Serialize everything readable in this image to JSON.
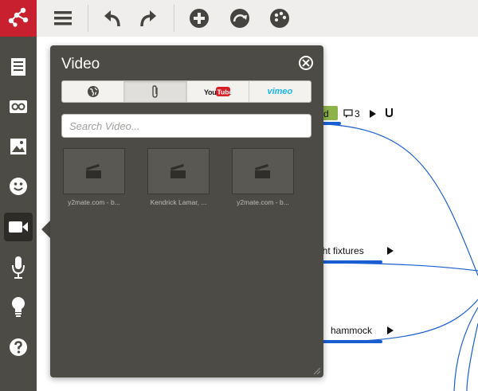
{
  "toolbar": {
    "logo": "mindmap-logo",
    "buttons": [
      "menu",
      "undo",
      "redo",
      "add",
      "connect",
      "theme"
    ]
  },
  "sidebar": {
    "items": [
      "notes",
      "links",
      "image",
      "emoji",
      "video",
      "audio",
      "idea",
      "help"
    ],
    "active": "video"
  },
  "canvas": {
    "nodes": [
      {
        "label": "d",
        "comment_count": "3"
      },
      {
        "label": "ght fixtures"
      },
      {
        "label": "hammock"
      }
    ]
  },
  "video_panel": {
    "title": "Video",
    "tabs": [
      {
        "id": "web",
        "label": ""
      },
      {
        "id": "attachment",
        "label": ""
      },
      {
        "id": "youtube",
        "label": "YouTube"
      },
      {
        "id": "vimeo",
        "label": "vimeo"
      }
    ],
    "active_tab": "attachment",
    "search_placeholder": "Search Video...",
    "videos": [
      {
        "caption": "y2mate.com - b..."
      },
      {
        "caption": "Kendrick Lamar, ..."
      },
      {
        "caption": "y2mate.com - b..."
      }
    ]
  },
  "colors": {
    "brand_red": "#c8202e",
    "panel_bg": "#4d4b45",
    "link_blue": "#1a5fd1",
    "badge_green": "#8db24a"
  }
}
